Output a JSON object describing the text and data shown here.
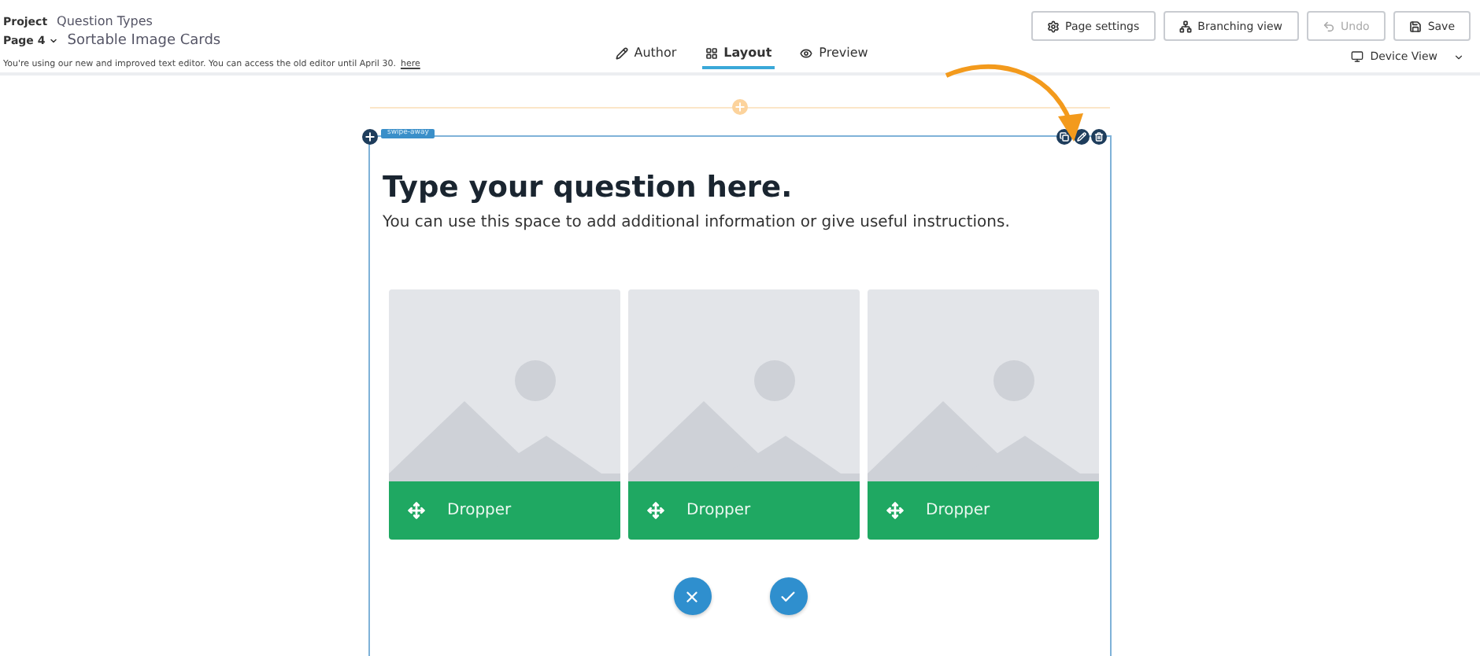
{
  "header": {
    "project_label": "Project",
    "project_name": "Question Types",
    "page_label": "Page 4",
    "page_title": "Sortable Image Cards",
    "notice": "You're using our new and improved text editor. You can access the old editor until April 30.",
    "notice_link": "here"
  },
  "tabs": [
    {
      "label": "Author",
      "selected": false
    },
    {
      "label": "Layout",
      "selected": true
    },
    {
      "label": "Preview",
      "selected": false
    }
  ],
  "toolbar_buttons": [
    {
      "label": "Page settings",
      "disabled": false
    },
    {
      "label": "Branching view",
      "disabled": false
    },
    {
      "label": "Undo",
      "disabled": true
    },
    {
      "label": "Save",
      "disabled": false
    }
  ],
  "device_view": "Device View",
  "question": {
    "tag": "swipe-away",
    "title": "Type your question here.",
    "description": "You can use this space to add additional information or give useful instructions.",
    "cards": [
      {
        "label": "Dropper",
        "kind": "picture"
      },
      {
        "label": "Dropper",
        "kind": "picture"
      },
      {
        "label": "Dropper",
        "kind": "picture"
      }
    ]
  }
}
